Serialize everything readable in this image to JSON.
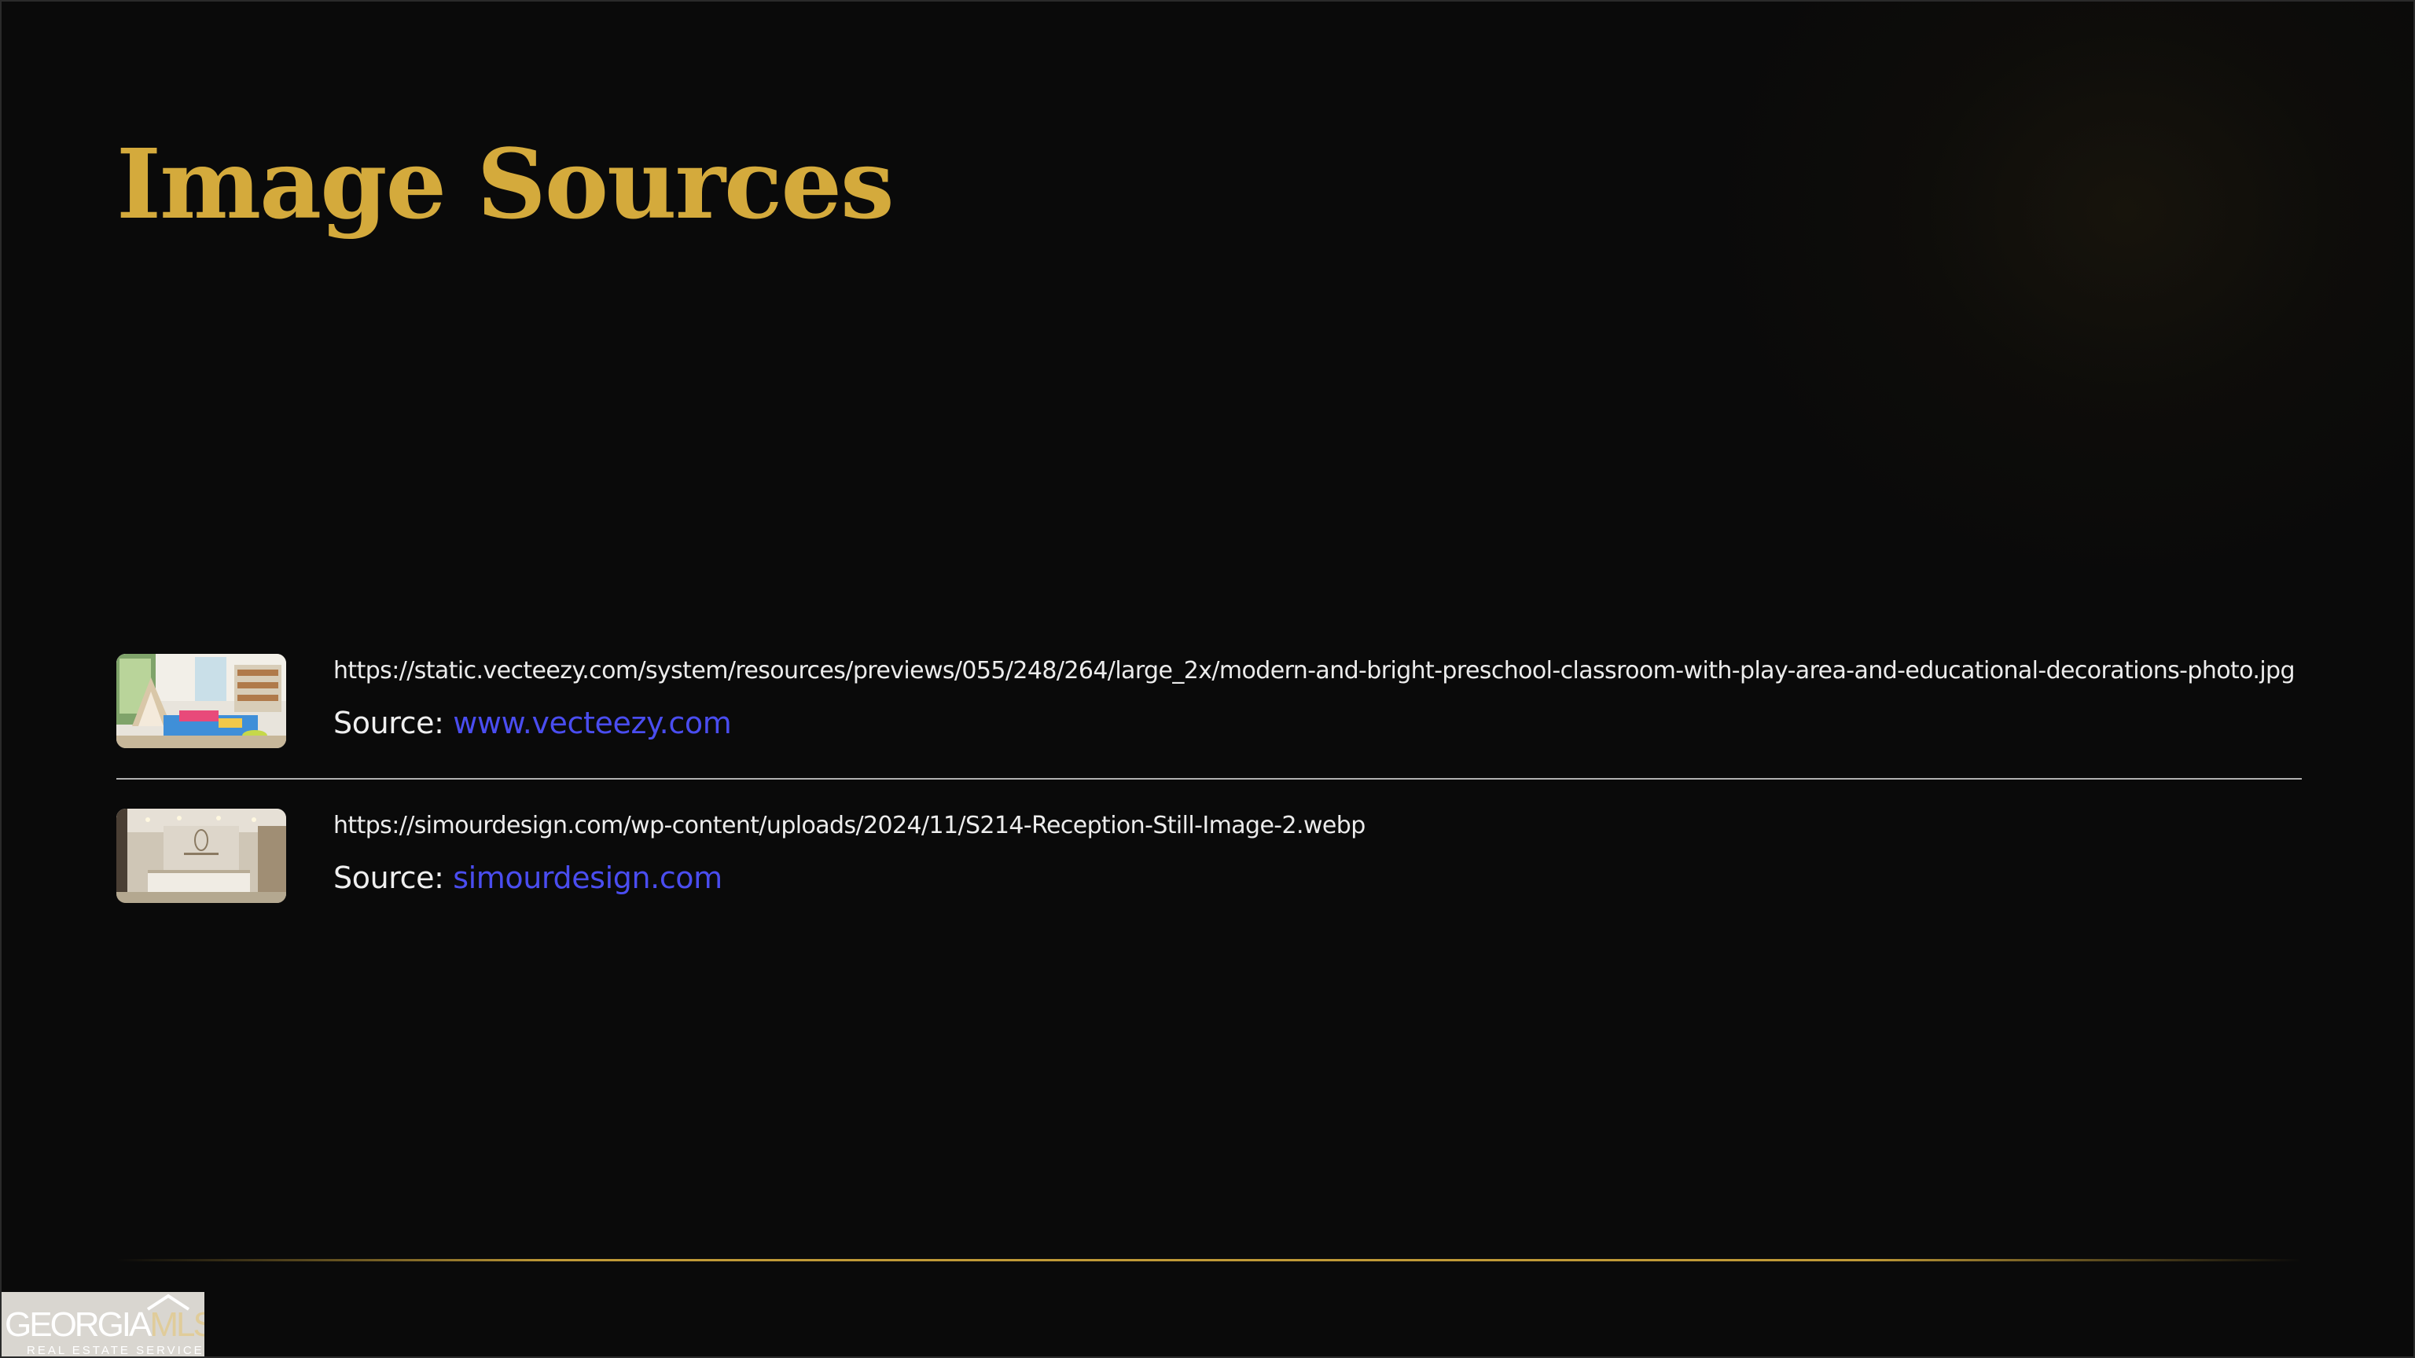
{
  "slide": {
    "title": "Image Sources"
  },
  "sources": [
    {
      "url": "https://static.vecteezy.com/system/resources/previews/055/248/264/large_2x/modern-and-bright-preschool-classroom-with-play-area-and-educational-decorations-photo.jpg",
      "source_label": "Source:",
      "source_link": "www.vecteezy.com",
      "thumbnail": "preschool-classroom-thumbnail"
    },
    {
      "url": "https://simourdesign.com/wp-content/uploads/2024/11/S214-Reception-Still-Image-2.webp",
      "source_label": "Source:",
      "source_link": "simourdesign.com",
      "thumbnail": "reception-lobby-thumbnail"
    }
  ],
  "logo": {
    "brand_left": "GEORGIA",
    "brand_right": "MLS",
    "tagline": "REAL ESTATE SERVICES"
  },
  "colors": {
    "background": "#0a0a0a",
    "title_gold": "#d4aa3c",
    "link_blue": "#4a4df0",
    "text": "#efefef"
  }
}
